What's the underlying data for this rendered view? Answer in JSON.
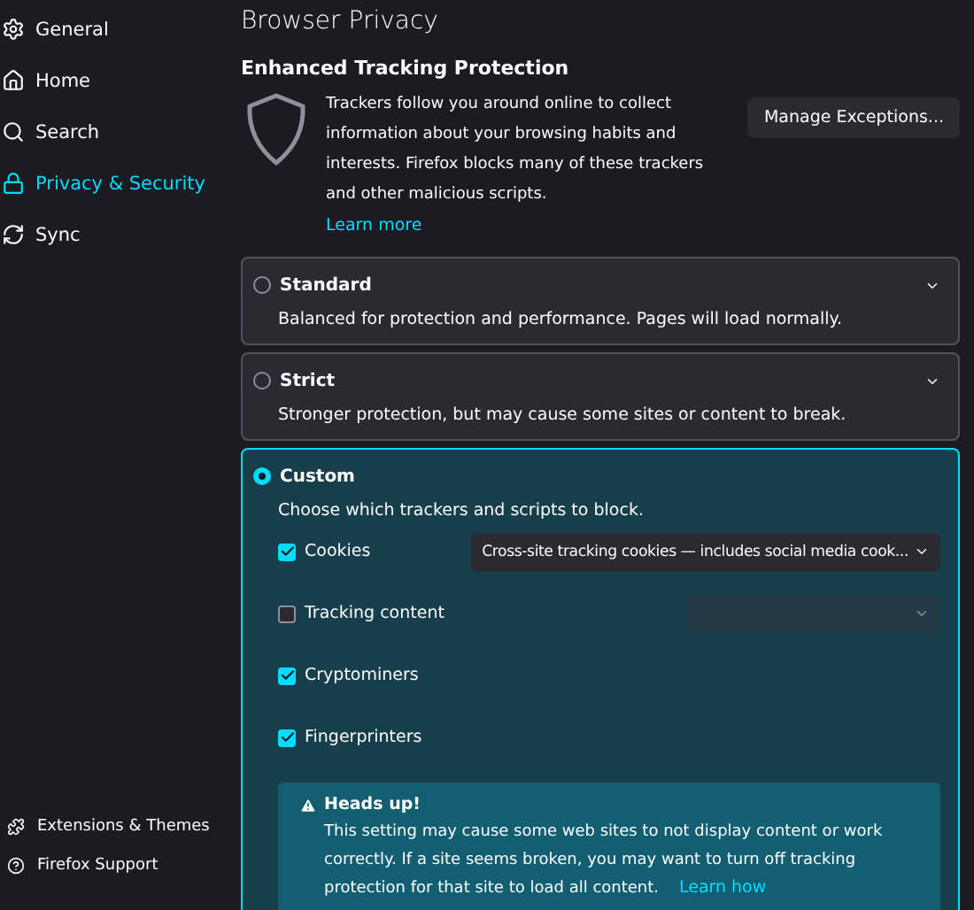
{
  "sidebar": {
    "items": [
      {
        "label": "General",
        "selected": false
      },
      {
        "label": "Home",
        "selected": false
      },
      {
        "label": "Search",
        "selected": false
      },
      {
        "label": "Privacy & Security",
        "selected": true
      },
      {
        "label": "Sync",
        "selected": false
      }
    ],
    "footer_items": [
      {
        "label": "Extensions & Themes"
      },
      {
        "label": "Firefox Support"
      }
    ]
  },
  "page": {
    "title": "Browser Privacy",
    "section_title": "Enhanced Tracking Protection",
    "description": "Trackers follow you around online to collect information about your browsing habits and interests. Firefox blocks many of these trackers and other malicious scripts.",
    "learn_more": "Learn more",
    "manage_button": "Manage Exceptions...",
    "options": [
      {
        "title": "Standard",
        "description": "Balanced for protection and performance. Pages will load normally.",
        "selected": false
      },
      {
        "title": "Strict",
        "description": "Stronger protection, but may cause some sites or content to break.",
        "selected": false
      },
      {
        "title": "Custom",
        "description": "Choose which trackers and scripts to block.",
        "selected": true,
        "trackers": [
          {
            "label": "Cookies",
            "checked": true,
            "dropdown": {
              "value": "Cross-site tracking cookies — includes social media cook...",
              "disabled": false
            }
          },
          {
            "label": "Tracking content",
            "checked": false,
            "dropdown": {
              "disabled": true
            }
          },
          {
            "label": "Cryptominers",
            "checked": true
          },
          {
            "label": "Fingerprinters",
            "checked": true
          }
        ],
        "warning": {
          "title": "Heads up!",
          "text": "This setting may cause some web sites to not display content or work correctly. If a site seems broken, you may want to turn off tracking protection for that site to load all content.",
          "link": "Learn how"
        }
      }
    ]
  }
}
